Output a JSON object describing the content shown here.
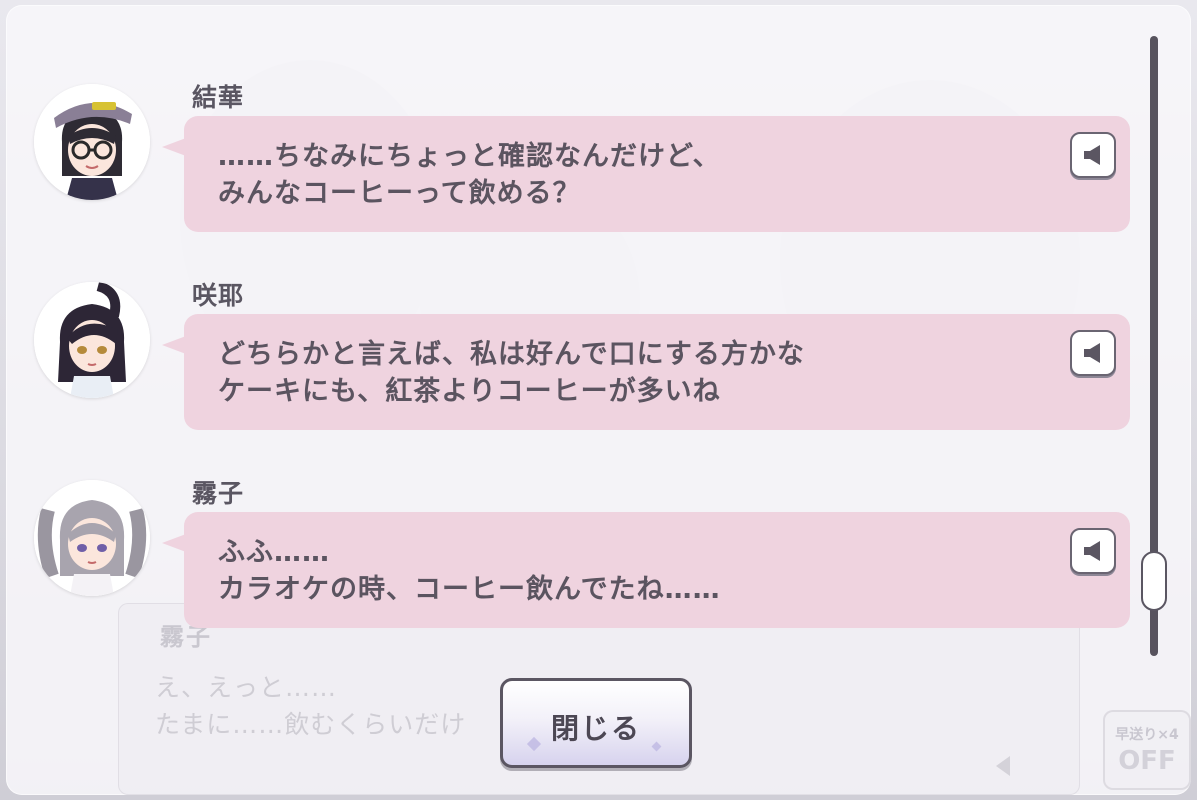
{
  "backlog": {
    "entries": [
      {
        "speaker": "結華",
        "line1": "……ちなみにちょっと確認なんだけど、",
        "line2": "みんなコーヒーって飲める？",
        "voice_icon": "speaker-icon"
      },
      {
        "speaker": "咲耶",
        "line1": "どちらかと言えば、私は好んで口にする方かな",
        "line2": "ケーキにも、紅茶よりコーヒーが多いね",
        "voice_icon": "speaker-icon"
      },
      {
        "speaker": "霧子",
        "line1": "ふふ……",
        "line2": "カラオケの時、コーヒー飲んでたね……",
        "voice_icon": "speaker-icon"
      }
    ],
    "close_label": "閉じる"
  },
  "background_dialogue": {
    "speaker": "霧子",
    "line1": "え、えっと……",
    "line2": "たまに……飲むくらいだけ",
    "fast_forward_label": "早送り×4",
    "fast_forward_state": "OFF"
  },
  "colors": {
    "bubble": "#efd3df",
    "text": "#5b5460",
    "border": "#5b5662"
  }
}
